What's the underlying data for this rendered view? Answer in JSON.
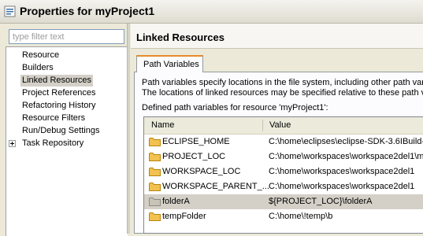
{
  "window": {
    "title": "Properties for myProject1"
  },
  "filter": {
    "placeholder": "type filter text"
  },
  "tree": {
    "items": [
      {
        "label": "Resource"
      },
      {
        "label": "Builders"
      },
      {
        "label": "Linked Resources",
        "selected": true
      },
      {
        "label": "Project References"
      },
      {
        "label": "Refactoring History"
      },
      {
        "label": "Resource Filters"
      },
      {
        "label": "Run/Debug Settings"
      },
      {
        "label": "Task Repository",
        "expandable": true
      }
    ]
  },
  "page": {
    "title": "Linked Resources",
    "tab": "Path Variables",
    "description_line1": "Path variables specify locations in the file system, including other path variab",
    "description_line2": "The locations of linked resources may be specified relative to these path varia",
    "defined_label": "Defined path variables for resource 'myProject1':"
  },
  "table": {
    "columns": {
      "name": "Name",
      "value": "Value"
    },
    "rows": [
      {
        "name": "ECLIPSE_HOME",
        "value": "C:\\home\\eclipses\\eclipse-SDK-3.6IBuild-w",
        "icon": "folder-icon"
      },
      {
        "name": "PROJECT_LOC",
        "value": "C:\\home\\workspaces\\workspace2del1\\myp",
        "icon": "folder-icon"
      },
      {
        "name": "WORKSPACE_LOC",
        "value": "C:\\home\\workspaces\\workspace2del1",
        "icon": "folder-icon"
      },
      {
        "name": "WORKSPACE_PARENT_...",
        "value": "C:\\home\\workspaces\\workspace2del1",
        "icon": "folder-icon"
      },
      {
        "name": "folderA",
        "value": "${PROJECT_LOC}\\folderA",
        "icon": "folder-icon",
        "selected": true
      },
      {
        "name": "tempFolder",
        "value": "C:\\home\\!temp\\b",
        "icon": "folder-icon"
      }
    ]
  },
  "colors": {
    "folder": "#f2c14e",
    "folder_selected": "#c8c4b8",
    "selected_row": "#d4d0c8",
    "tab_accent": "#e68b2c"
  }
}
